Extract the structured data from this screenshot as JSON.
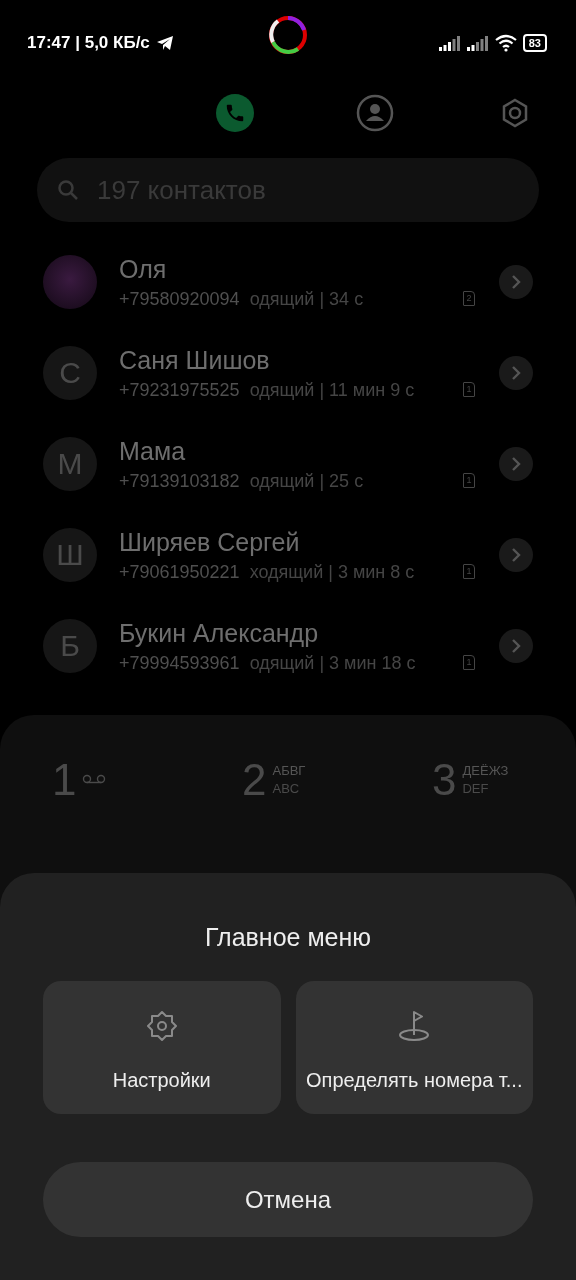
{
  "status_bar": {
    "time": "17:47 | 5,0 КБ/с",
    "battery": "83"
  },
  "tabs": [
    {
      "kind": "calls",
      "selected": true
    },
    {
      "kind": "contacts",
      "selected": false
    },
    {
      "kind": "settings",
      "selected": false
    }
  ],
  "search": {
    "placeholder": "197 контактов"
  },
  "calls": [
    {
      "kind": "photo",
      "name": "Оля",
      "phone": "+79580920094",
      "info": "одящий | 34 с",
      "sim": "2"
    },
    {
      "kind": "letter",
      "avatar": "С",
      "name": "Саня Шишов",
      "phone": "+79231975525",
      "info": "одящий | 11 мин 9 с",
      "sim": "1"
    },
    {
      "kind": "letter",
      "avatar": "М",
      "name": "Мама",
      "phone": "+79139103182",
      "info": "одящий | 25 с",
      "sim": "1"
    },
    {
      "kind": "letter",
      "avatar": "Ш",
      "name": "Ширяев Сергей",
      "phone": "+79061950221",
      "info": "ходящий | 3 мин 8 с",
      "sim": "1"
    },
    {
      "kind": "letter",
      "avatar": "Б",
      "name": "Букин Александр",
      "phone": "+79994593961",
      "info": "одящий | 3 мин 18 с",
      "sim": "1"
    }
  ],
  "dialpad": [
    {
      "digit": "1",
      "kind": "voicemail"
    },
    {
      "digit": "2",
      "kind": "letters",
      "letters": "АБВГ",
      "latin": "ABC"
    },
    {
      "digit": "3",
      "kind": "letters",
      "letters": "ДЕЁЖЗ",
      "latin": "DEF"
    }
  ],
  "menu": {
    "title": "Главное меню",
    "items": [
      {
        "kind": "settings",
        "label": "Настройки"
      },
      {
        "kind": "flag",
        "label": "Определять номера т..."
      }
    ],
    "cancel": "Отмена"
  }
}
